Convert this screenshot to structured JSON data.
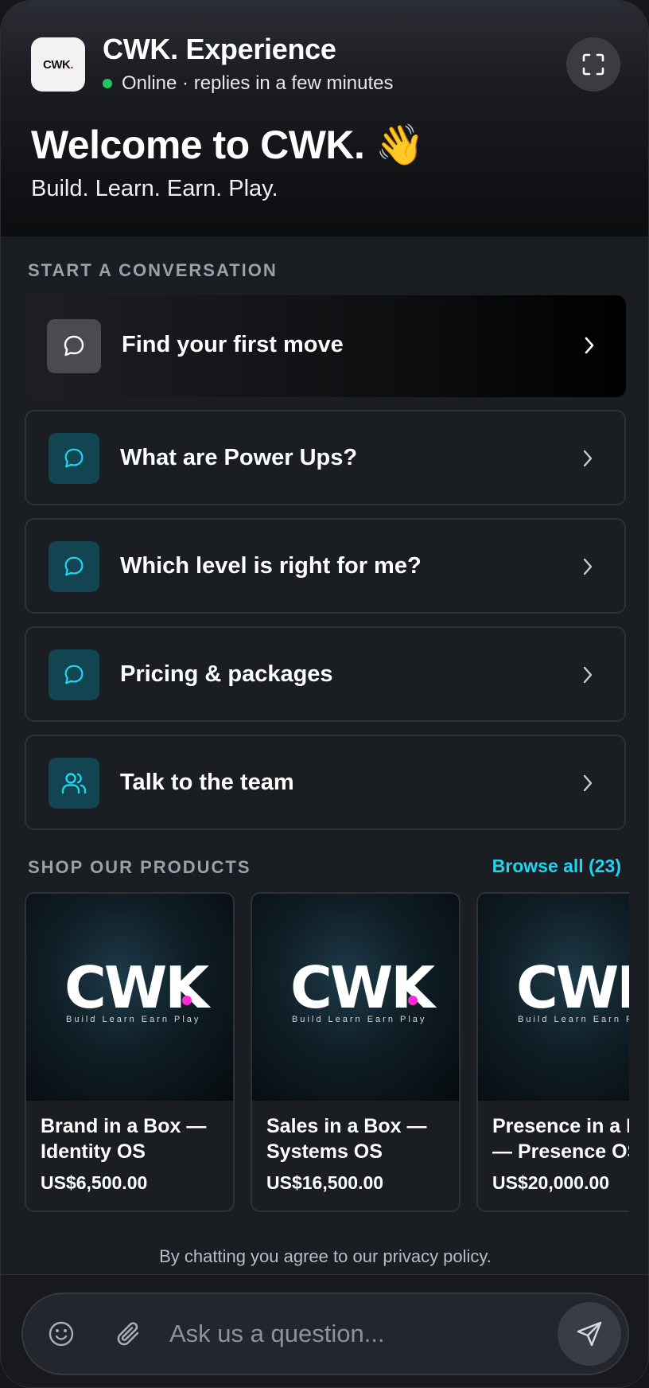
{
  "header": {
    "logo_text": "CWK.",
    "title": "CWK. Experience",
    "status": "Online · replies in a few minutes",
    "welcome": "Welcome to CWK. 👋",
    "tagline": "Build. Learn. Earn. Play."
  },
  "conversation": {
    "section_label": "START A CONVERSATION",
    "items": [
      {
        "label": "Find your first move",
        "icon": "chat-bubble-icon"
      },
      {
        "label": "What are Power Ups?",
        "icon": "chat-bubble-icon"
      },
      {
        "label": "Which level is right for me?",
        "icon": "chat-bubble-icon"
      },
      {
        "label": "Pricing & packages",
        "icon": "chat-bubble-icon"
      },
      {
        "label": "Talk to the team",
        "icon": "users-icon"
      }
    ]
  },
  "shop": {
    "section_label": "SHOP OUR PRODUCTS",
    "browse_label": "Browse all (23)",
    "product_logo": "CWK",
    "product_logo_sub": "Build  Learn  Earn  Play",
    "products": [
      {
        "title": "Brand in a Box — Identity OS",
        "price": "US$6,500.00"
      },
      {
        "title": "Sales in a Box — Systems OS",
        "price": "US$16,500.00"
      },
      {
        "title": "Presence in a Box — Presence OS",
        "price": "US$20,000.00"
      }
    ]
  },
  "footer": {
    "privacy": "By chatting you agree to our privacy policy.",
    "input_placeholder": "Ask us a question..."
  },
  "colors": {
    "accent": "#22d3ee",
    "online": "#22c55e",
    "icon_tile": "#134452",
    "brand_pink": "#ff2bd6"
  }
}
